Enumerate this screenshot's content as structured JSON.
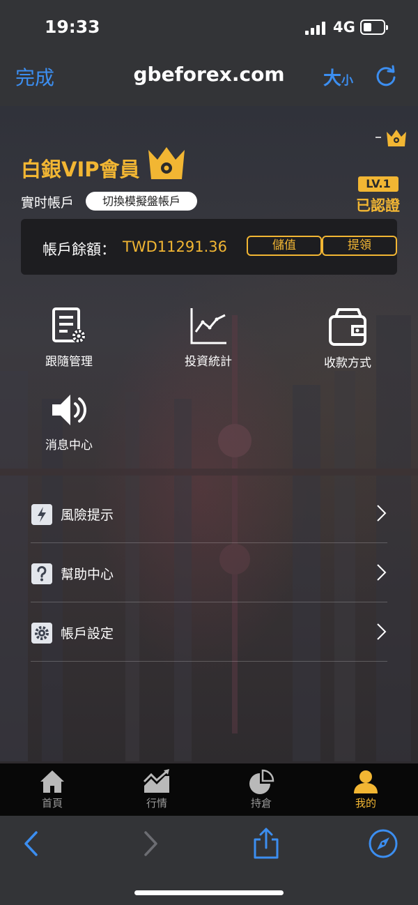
{
  "status": {
    "time": "19:33",
    "network": "4G"
  },
  "browser": {
    "done_label": "完成",
    "url": "gbeforex.com",
    "textsize_big": "大",
    "textsize_small": "小"
  },
  "profile": {
    "vip_title": "白銀VIP會員",
    "account_type": "實时帳戶",
    "switch_label": "切換模擬盤帳戶",
    "level": "LV.1",
    "verified": "已認證"
  },
  "balance": {
    "label": "帳戶餘額：",
    "value": "TWD11291.36",
    "deposit_label": "儲值",
    "withdraw_label": "提領"
  },
  "grid": [
    {
      "label": "跟隨管理",
      "icon": "document-gear-icon"
    },
    {
      "label": "投資統計",
      "icon": "line-chart-icon"
    },
    {
      "label": "收款方式",
      "icon": "wallet-icon"
    },
    {
      "label": "消息中心",
      "icon": "speaker-icon"
    }
  ],
  "menu": [
    {
      "label": "風險提示",
      "icon": "lightning-icon"
    },
    {
      "label": "幫助中心",
      "icon": "question-icon"
    },
    {
      "label": "帳戶設定",
      "icon": "gear-icon"
    }
  ],
  "tabs": [
    {
      "label": "首頁",
      "icon": "home-icon"
    },
    {
      "label": "行情",
      "icon": "market-chart-icon"
    },
    {
      "label": "持倉",
      "icon": "pie-chart-icon"
    },
    {
      "label": "我的",
      "icon": "user-icon",
      "active": true
    }
  ],
  "colors": {
    "accent": "#f2b633",
    "link": "#3c8ef0",
    "tab_inactive": "#9a9a9a"
  }
}
